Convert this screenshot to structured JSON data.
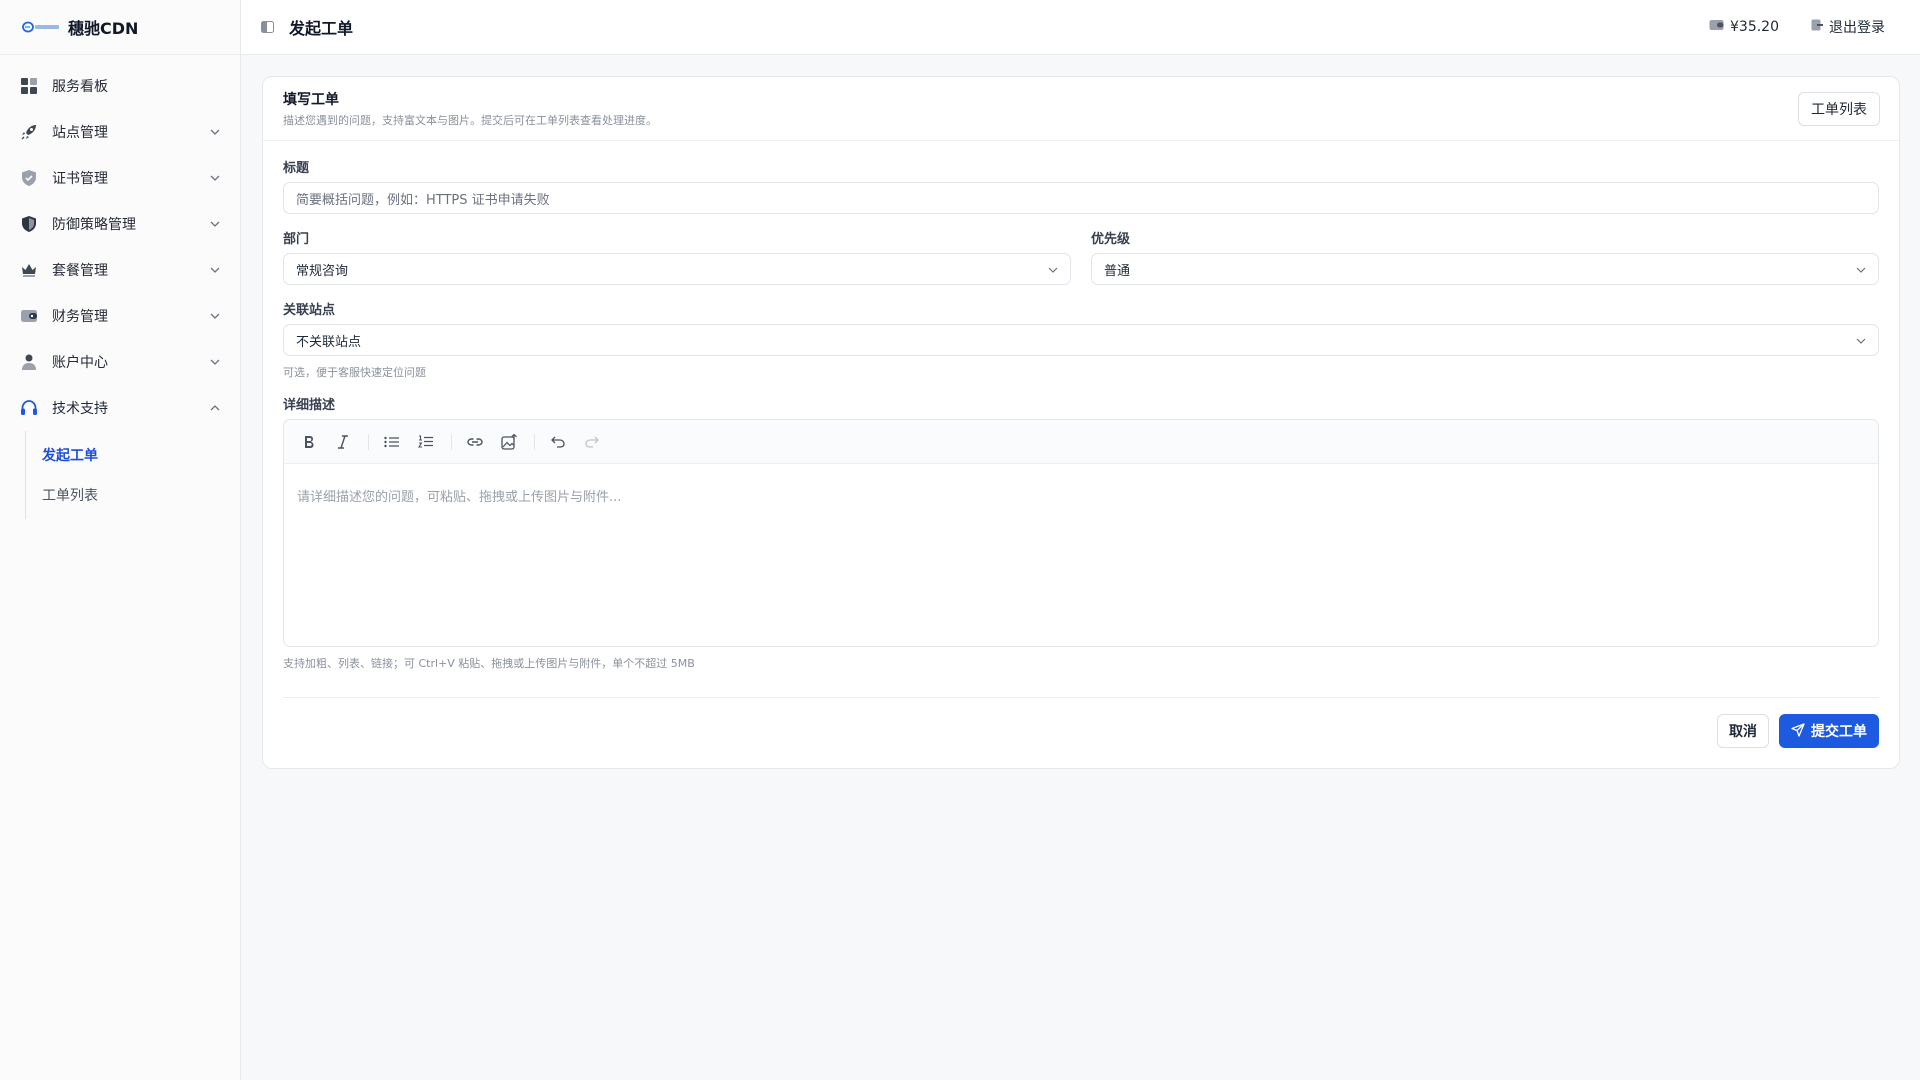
{
  "brand": {
    "name": "穗驰CDN",
    "logo_icon": "brand-logo-icon"
  },
  "sidebar": {
    "items": [
      {
        "label": "服务看板",
        "icon": "dashboard-icon",
        "expandable": false
      },
      {
        "label": "站点管理",
        "icon": "rocket-icon",
        "expandable": true
      },
      {
        "label": "证书管理",
        "icon": "shield-check-icon",
        "expandable": true
      },
      {
        "label": "防御策略管理",
        "icon": "shield-half-icon",
        "expandable": true
      },
      {
        "label": "套餐管理",
        "icon": "crown-icon",
        "expandable": true
      },
      {
        "label": "财务管理",
        "icon": "wallet-icon",
        "expandable": true
      },
      {
        "label": "账户中心",
        "icon": "user-icon",
        "expandable": true
      },
      {
        "label": "技术支持",
        "icon": "headset-icon",
        "expandable": true,
        "expanded": true
      }
    ],
    "sub_items": [
      {
        "label": "发起工单",
        "active": true
      },
      {
        "label": "工单列表",
        "active": false
      }
    ]
  },
  "topbar": {
    "title": "发起工单",
    "balance": "¥35.20",
    "logout": "退出登录"
  },
  "card": {
    "title": "填写工单",
    "description": "描述您遇到的问题，支持富文本与图片。提交后可在工单列表查看处理进度。",
    "list_button": "工单列表"
  },
  "form": {
    "title_label": "标题",
    "title_placeholder": "简要概括问题，例如：HTTPS 证书申请失败",
    "department_label": "部门",
    "department_value": "常规咨询",
    "priority_label": "优先级",
    "priority_value": "普通",
    "site_label": "关联站点",
    "site_value": "不关联站点",
    "site_hint": "可选，便于客服快速定位问题",
    "detail_label": "详细描述",
    "detail_placeholder": "请详细描述您的问题，可粘贴、拖拽或上传图片与附件...",
    "detail_hint": "支持加粗、列表、链接；可 Ctrl+V 粘贴、拖拽或上传图片与附件，单个不超过 5MB",
    "cancel_label": "取消",
    "submit_label": "提交工单"
  },
  "colors": {
    "accent": "#1d5ae0",
    "active_link": "#1d4ed8"
  }
}
